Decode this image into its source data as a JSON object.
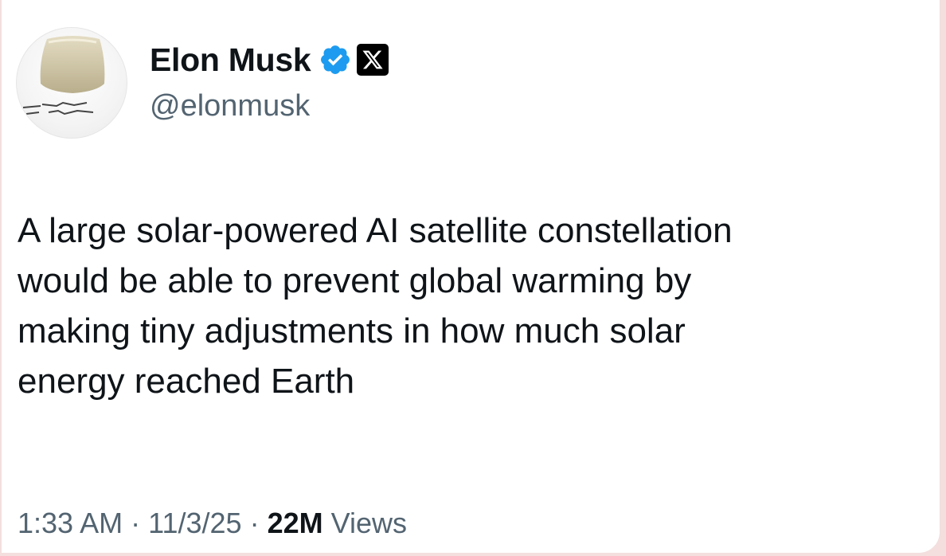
{
  "tweet": {
    "author": {
      "name": "Elon Musk",
      "handle": "@elonmusk",
      "verified_icon": "verified-badge-icon",
      "affiliation_icon": "x-logo-icon",
      "verified_color": "#1d9bf0"
    },
    "lines": [
      "A large solar-powered AI satellite constellation",
      "would be able to prevent global warming by",
      "making tiny adjustments in how much solar",
      "energy reached Earth"
    ],
    "time": "1:33 AM",
    "separator": "·",
    "date": "11/3/25",
    "views_count": "22M",
    "views_label": "Views"
  }
}
